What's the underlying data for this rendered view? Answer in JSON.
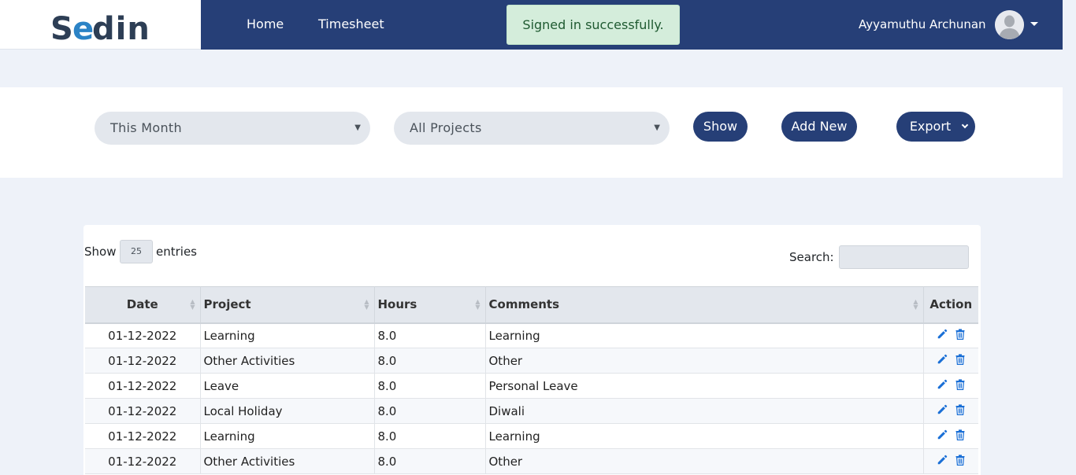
{
  "header": {
    "logo_text": "Sedin",
    "nav": [
      {
        "label": "Home"
      },
      {
        "label": "Timesheet"
      }
    ],
    "toast": "Signed in successfully.",
    "user_name": "Ayyamuthu Archunan"
  },
  "filters": {
    "period": "This Month",
    "project": "All Projects",
    "show_label": "Show",
    "add_new_label": "Add New",
    "export_label": "Export"
  },
  "table_controls": {
    "show_label": "Show",
    "entries_value": "25",
    "entries_label": "entries",
    "search_label": "Search:"
  },
  "table": {
    "columns": [
      "Date",
      "Project",
      "Hours",
      "Comments",
      "Action"
    ],
    "rows": [
      {
        "date": "01-12-2022",
        "project": "Learning",
        "hours": "8.0",
        "comments": "Learning"
      },
      {
        "date": "01-12-2022",
        "project": "Other Activities",
        "hours": "8.0",
        "comments": "Other"
      },
      {
        "date": "01-12-2022",
        "project": "Leave",
        "hours": "8.0",
        "comments": "Personal Leave"
      },
      {
        "date": "01-12-2022",
        "project": "Local Holiday",
        "hours": "8.0",
        "comments": "Diwali"
      },
      {
        "date": "01-12-2022",
        "project": "Learning",
        "hours": "8.0",
        "comments": "Learning"
      },
      {
        "date": "01-12-2022",
        "project": "Other Activities",
        "hours": "8.0",
        "comments": "Other"
      }
    ]
  },
  "colors": {
    "navbar": "#263f77",
    "accent_icon": "#1a6fd6",
    "toast_bg": "#d4eddb"
  },
  "icons": {
    "edit": "pencil-icon",
    "delete": "trash-icon",
    "user": "user-avatar-icon"
  }
}
